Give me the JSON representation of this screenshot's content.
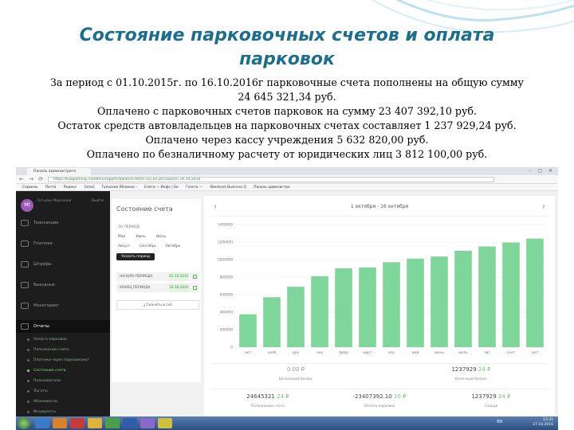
{
  "slide": {
    "title_line1": "Состояние парковочных счетов  и  оплата",
    "title_line2": "парковок",
    "lines": [
      "За период с 01.10.2015г. по 16.10.2016г  парковочные счета пополнены на общую сумму",
      "24 645 321,34 руб.",
      "Оплачено   с парковочных счетов    парковок  на сумму 23 407 392,10 руб.",
      "Остаток  средств  автовладельцев на парковочных счетах составляет 1 237 929,24 руб.",
      "Оплачено через кассу учреждения 5 632 820,00 руб.",
      "Оплачено по безналичному расчету  от юридических лиц   3 812 100,00 руб."
    ]
  },
  "browser": {
    "tab_label": "Панель администрато",
    "url": "https://tulaparking.ru/admin/reports/balance?start=01.10.2015&end=16.10.2016",
    "bookmarks": [
      "Сервисы",
      "Почта",
      "Яндекс",
      "Gmail",
      "Тульские Ябланки -",
      "Блоги — Инфо | Бе",
      "Газета —",
      "Sberbank Business O",
      "Панель администра"
    ]
  },
  "sidebar": {
    "avatar_initials": "Mt",
    "user_name": "Татьяна Морозова",
    "logout": "Выйти",
    "items": [
      {
        "label": "Трансакции"
      },
      {
        "label": "Платежи"
      },
      {
        "label": "Штрафы"
      },
      {
        "label": "Выездные"
      },
      {
        "label": "Мониторинг"
      },
      {
        "label": "Отчеты"
      }
    ],
    "sub_items": [
      {
        "label": "Оплата парковок"
      },
      {
        "label": "Пополнение счета"
      },
      {
        "label": "Платежи через парковкомат"
      },
      {
        "label": "Состояние счета"
      },
      {
        "label": "Пользователи"
      },
      {
        "label": "Льготы"
      },
      {
        "label": "Абонементы"
      },
      {
        "label": "Инциденты"
      },
      {
        "label": "Длительность сессий"
      }
    ]
  },
  "panel": {
    "title": "Состояние счета",
    "period_label": "ЗА ПЕРИОД:",
    "months_row1": [
      "Май",
      "Июнь",
      "Июль"
    ],
    "months_row2": [
      "Август",
      "Сентябрь",
      "Октябрь"
    ],
    "set_period_button": "Указать период",
    "start_label": "НАЧАЛО ПЕРИОДА",
    "start_value": "01.10.2015",
    "end_label": "КОНЕЦ ПЕРИОДА",
    "end_value": "16.10.2016",
    "csv_button": "Скачать в csv"
  },
  "chart_header": {
    "period": "1 октября - 16 октября",
    "prev": "‹",
    "next": "›"
  },
  "chart_data": {
    "type": "bar",
    "categories": [
      "окт",
      "нояб",
      "дек",
      "янв",
      "февр",
      "март",
      "апр",
      "май",
      "июнь",
      "июль",
      "авг",
      "сент",
      "окт"
    ],
    "values": [
      375000,
      570000,
      690000,
      810000,
      900000,
      910000,
      970000,
      1010000,
      1035000,
      1100000,
      1150000,
      1195000,
      1240000
    ],
    "ylim": [
      0,
      1400000
    ],
    "y_ticks": [
      0,
      200000,
      400000,
      600000,
      800000,
      1000000,
      1200000,
      1400000
    ],
    "grid": true,
    "bar_color": "#7fd69a"
  },
  "stats": {
    "opening_value": "0.00",
    "opening_label": "Начальный баланс",
    "closing_value": "1237929",
    "closing_label": "Конечный баланс",
    "topup_value": "24645321",
    "topup_label": "Пополнение счета",
    "paid_value": "-23407392.10",
    "paid_label": "Оплата парковок",
    "balance_value": "1237929",
    "balance_label": "Сальдо",
    "cur_24": "24",
    "cur_10": "10",
    "rub": "₽"
  },
  "taskbar": {
    "lang": "EN",
    "time": "13:31",
    "date": "27.10.2016"
  }
}
